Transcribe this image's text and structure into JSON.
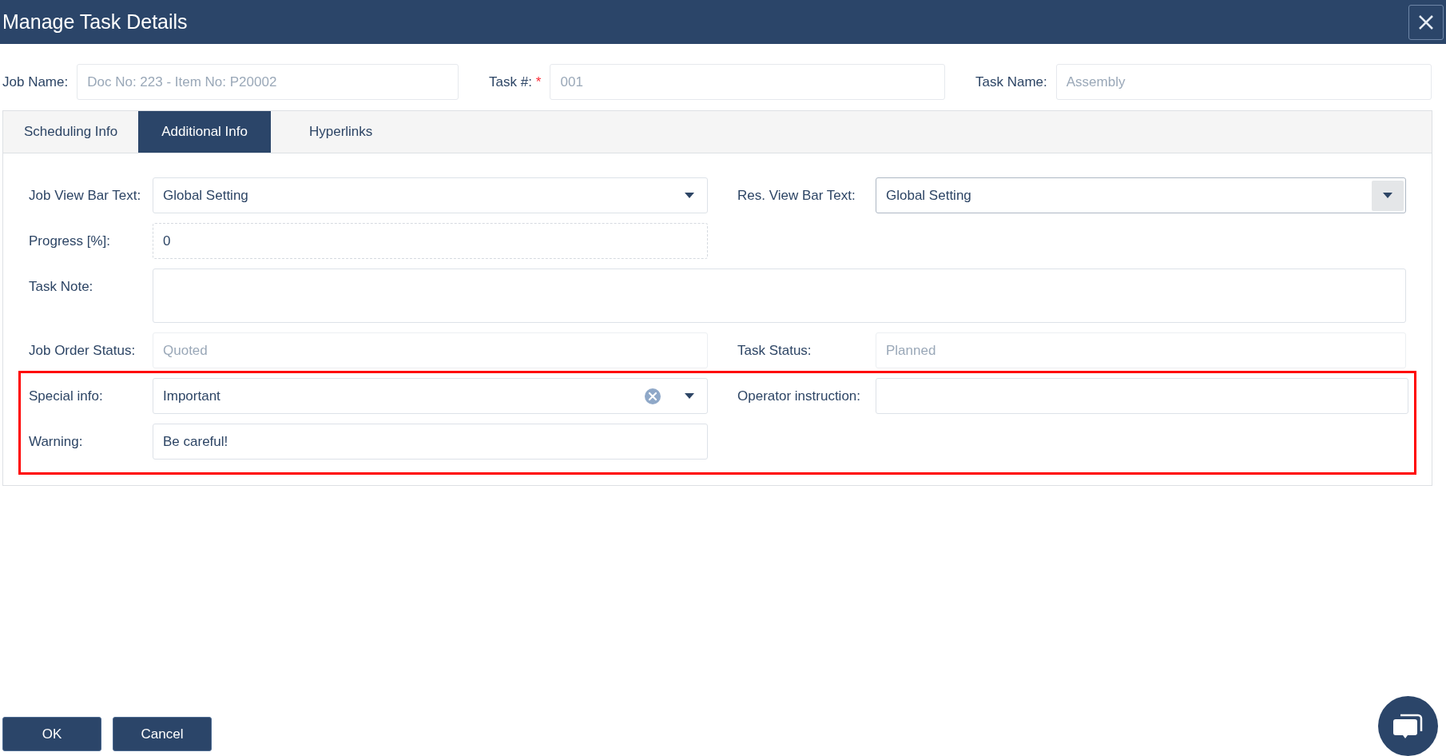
{
  "window": {
    "title": "Manage Task Details"
  },
  "header_fields": [
    {
      "label": "Job Name:",
      "value": "Doc No: 223 - Item No: P20002",
      "disabled": true
    },
    {
      "label": "Task #:",
      "required_mark": "*",
      "value": "001",
      "disabled": true
    },
    {
      "label": "Task Name:",
      "value": "Assembly",
      "disabled": true
    }
  ],
  "tabs": [
    {
      "label": "Scheduling Info",
      "selected": false
    },
    {
      "label": "Additional Info",
      "selected": true
    },
    {
      "label": "Hyperlinks",
      "selected": false
    }
  ],
  "rows": [
    {
      "highlighted": false,
      "cells": [
        {
          "label": "Job View Bar Text:",
          "kind": "select",
          "value": "Global Setting",
          "disabled": false
        },
        {
          "label": "Res. View Bar Text:",
          "kind": "select_button",
          "value": "Global Setting",
          "disabled": false
        }
      ]
    },
    {
      "highlighted": false,
      "cells": [
        {
          "label": "Progress [%]:",
          "kind": "numeric",
          "value": "0",
          "disabled": false
        }
      ]
    },
    {
      "highlighted": false,
      "cells": [
        {
          "label": "Task Note:",
          "kind": "textarea",
          "disabled": false
        }
      ]
    },
    {
      "highlighted": false,
      "cells": [
        {
          "label": "Job Order Status:",
          "kind": "text",
          "value": "Quoted",
          "disabled": true
        },
        {
          "label": "Task Status:",
          "kind": "text",
          "value": "Planned",
          "disabled": true
        }
      ]
    },
    {
      "highlighted": true,
      "cells": [
        {
          "label": "Special info:",
          "kind": "select_clearable",
          "value": "Important",
          "disabled": false
        },
        {
          "label": "Operator instruction:",
          "kind": "text",
          "disabled": false
        }
      ]
    },
    {
      "highlighted": true,
      "cells": [
        {
          "label": "Warning:",
          "kind": "text",
          "value": "Be careful!",
          "disabled": false
        }
      ]
    }
  ],
  "buttons": [
    {
      "label": "OK"
    },
    {
      "label": "Cancel"
    }
  ]
}
